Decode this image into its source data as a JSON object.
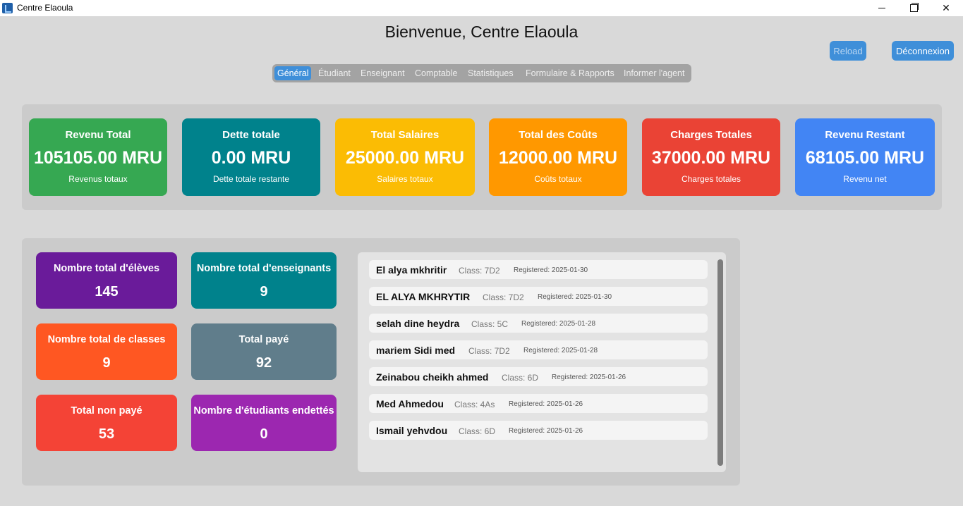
{
  "window": {
    "title": "Centre Elaoula"
  },
  "header": {
    "welcome": "Bienvenue, Centre Elaoula",
    "reload_label": "Reload",
    "logout_label": "Déconnexion"
  },
  "tabs": [
    "Général",
    "Étudiant",
    "Enseignant",
    "Comptable",
    "Statistiques",
    "Formulaire & Rapports",
    "Informer l'agent"
  ],
  "active_tab": "Général",
  "kpis": [
    {
      "title": "Revenu Total",
      "value": "105105.00 MRU",
      "subtitle": "Revenus totaux",
      "color": "#36a852"
    },
    {
      "title": "Dette totale",
      "value": "0.00 MRU",
      "subtitle": "Dette totale restante",
      "color": "#00828c"
    },
    {
      "title": "Total Salaires",
      "value": "25000.00 MRU",
      "subtitle": "Salaires totaux",
      "color": "#fbbc04"
    },
    {
      "title": "Total des Coûts",
      "value": "12000.00 MRU",
      "subtitle": "Coûts totaux",
      "color": "#ff9800"
    },
    {
      "title": "Charges Totales",
      "value": "37000.00 MRU",
      "subtitle": "Charges totales",
      "color": "#ea4335"
    },
    {
      "title": "Revenu Restant",
      "value": "68105.00 MRU",
      "subtitle": "Revenu net",
      "color": "#4285f4"
    }
  ],
  "stats": [
    {
      "title": "Nombre total d'élèves",
      "value": "145",
      "color": "#6a1b9a"
    },
    {
      "title": "Nombre total d'enseignants",
      "value": "9",
      "color": "#00828c"
    },
    {
      "title": "Nombre total de classes",
      "value": "9",
      "color": "#ff5722"
    },
    {
      "title": "Total payé",
      "value": "92",
      "color": "#607d8b"
    },
    {
      "title": "Total non payé",
      "value": "53",
      "color": "#f44336"
    },
    {
      "title": "Nombre d'étudiants endettés",
      "value": "0",
      "color": "#9c27b0"
    }
  ],
  "students": [
    {
      "name": "El alya mkhritir",
      "class": "Class: 7D2",
      "registered": "Registered: 2025-01-30"
    },
    {
      "name": "EL ALYA MKHRYTIR",
      "class": "Class: 7D2",
      "registered": "Registered: 2025-01-30"
    },
    {
      "name": "selah dine heydra",
      "class": "Class: 5C",
      "registered": "Registered: 2025-01-28"
    },
    {
      "name": "mariem Sidi med",
      "class": "Class: 7D2",
      "registered": "Registered: 2025-01-28"
    },
    {
      "name": "Zeinabou cheikh ahmed",
      "class": "Class: 6D",
      "registered": "Registered: 2025-01-26"
    },
    {
      "name": "Med Ahmedou",
      "class": "Class: 4As",
      "registered": "Registered: 2025-01-26"
    },
    {
      "name": "Ismail yehvdou",
      "class": "Class: 6D",
      "registered": "Registered: 2025-01-26"
    }
  ]
}
